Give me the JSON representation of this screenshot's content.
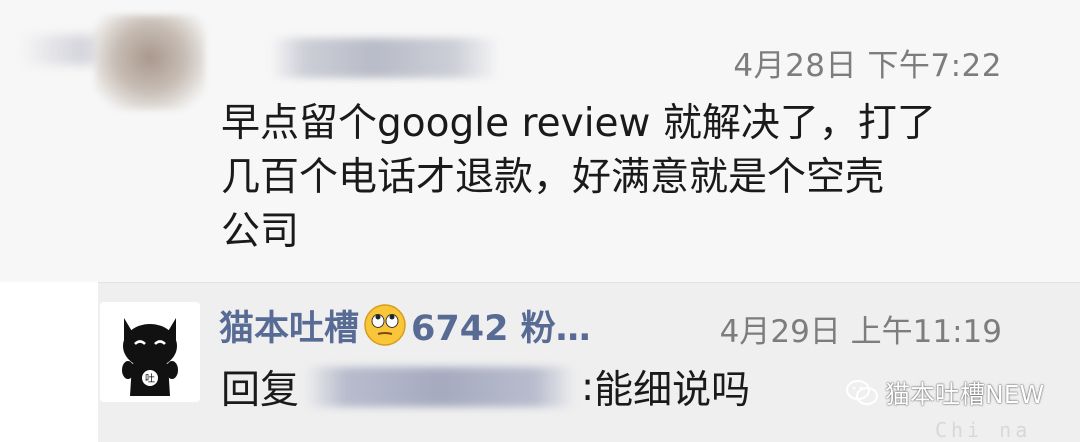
{
  "comment": {
    "timestamp": "4月28日 下午7:22",
    "lines": [
      "早点留个google review 就解决了，打了",
      "几百个电话才退款，好满意就是个空壳",
      "公司"
    ]
  },
  "reply": {
    "author": "猫本吐槽",
    "author_suffix": "6742 粉…",
    "emoji": "eye-roll-emoji",
    "timestamp": "4月29日 上午11:19",
    "prefix": "回复",
    "separator": ":",
    "text": "能细说吗"
  },
  "watermark": {
    "label": "猫本吐槽NEW",
    "sub": "Chi na"
  }
}
